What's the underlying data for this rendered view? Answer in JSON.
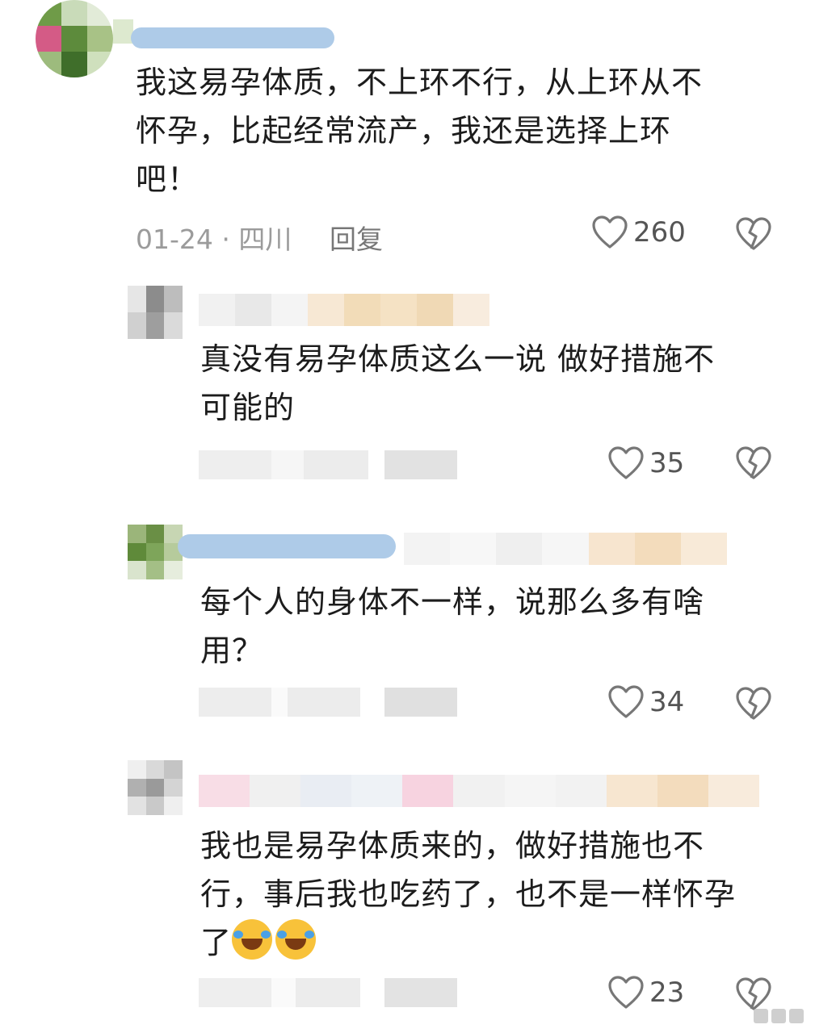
{
  "comments": [
    {
      "text_lines": [
        "我这易孕体质，不上环不行，从上环从不",
        "怀孕，比起经常流产，我还是选择上环",
        "吧！"
      ],
      "date_location": "01-24 · 四川",
      "reply_label": "回复",
      "likes": "260"
    },
    {
      "text_lines": [
        "真没有易孕体质这么一说 做好措施不",
        "可能的"
      ],
      "likes": "35"
    },
    {
      "text_lines": [
        "每个人的身体不一样，说那么多有啥",
        "用？"
      ],
      "likes": "34"
    },
    {
      "text_lines": [
        "我也是易孕体质来的，做好措施也不",
        "行，事后我也吃药了，也不是一样怀孕",
        "了"
      ],
      "emoji": [
        "laugh-cry-emoji",
        "laugh-cry-emoji"
      ],
      "likes": "23"
    }
  ],
  "colors": {
    "like_stroke": "#777777",
    "meta_text": "#9b9b9b",
    "pill_blur": "#aecbe8"
  },
  "icons": [
    "heart-icon",
    "broken-heart-icon"
  ]
}
